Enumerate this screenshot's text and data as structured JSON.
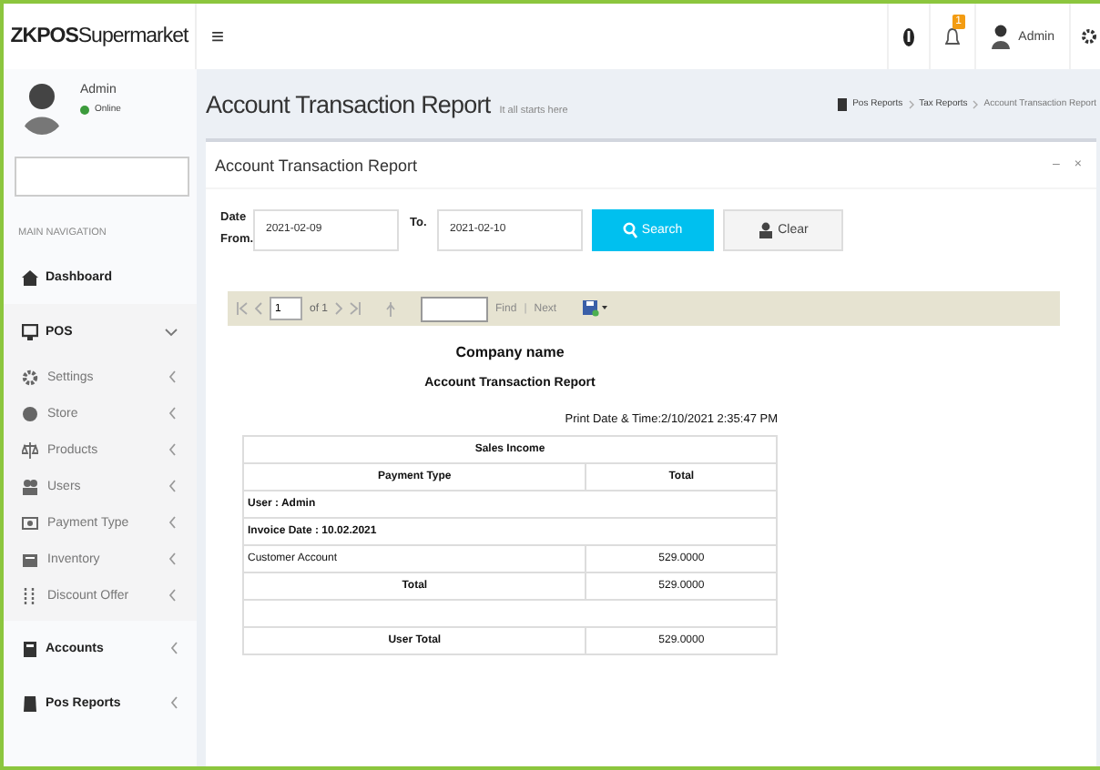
{
  "brand": {
    "bold": "ZKPOS",
    "light": "Supermarket"
  },
  "header": {
    "menu_toggle": "≡",
    "notification_count": "1",
    "user_name": "Admin"
  },
  "sidebar": {
    "user": {
      "name": "Admin",
      "status": "Online",
      "online": true
    },
    "nav_heading": "MAIN NAVIGATION",
    "items": [
      {
        "label": "Dashboard",
        "kind": "link"
      },
      {
        "label": "POS",
        "kind": "menu",
        "expanded": true,
        "children": [
          {
            "label": "Settings"
          },
          {
            "label": "Store"
          },
          {
            "label": "Products"
          },
          {
            "label": "Users"
          },
          {
            "label": "Payment Type"
          },
          {
            "label": "Inventory"
          },
          {
            "label": "Discount Offer"
          }
        ]
      },
      {
        "label": "Accounts",
        "kind": "menu",
        "expanded": false
      },
      {
        "label": "Pos Reports",
        "kind": "menu",
        "expanded": false
      }
    ]
  },
  "page": {
    "title": "Account Transaction Report",
    "subtitle": "It all starts here",
    "breadcrumb": [
      "Pos Reports",
      "Tax Reports",
      "Account Transaction Report"
    ]
  },
  "box": {
    "title": "Account Transaction Report",
    "tools": [
      "–",
      "×"
    ],
    "form": {
      "from_label": "Date From.",
      "from_value": "2021-02-09",
      "to_label": "To.",
      "to_value": "2021-02-10",
      "search_label": "Search",
      "clear_label": "Clear"
    },
    "toolbar": {
      "page": "1",
      "of_label": "of 1",
      "find_label": "Find",
      "separator": "|",
      "next_label": "Next"
    },
    "report": {
      "company": "Company name",
      "title": "Account Transaction Report",
      "print_info": "Print Date & Time:2/10/2021 2:35:47 PM",
      "section": "Sales Income",
      "columns": [
        "Payment Type",
        "Total"
      ],
      "rows": [
        {
          "kind": "group",
          "text": "User : Admin"
        },
        {
          "kind": "group",
          "text": "Invoice Date : 10.02.2021"
        },
        {
          "kind": "item",
          "cells": [
            "Customer Account",
            "529.0000"
          ]
        },
        {
          "kind": "total",
          "cells": [
            "Total",
            "529.0000"
          ]
        },
        {
          "kind": "blank"
        },
        {
          "kind": "total",
          "cells": [
            "User Total",
            "529.0000"
          ]
        }
      ]
    }
  }
}
